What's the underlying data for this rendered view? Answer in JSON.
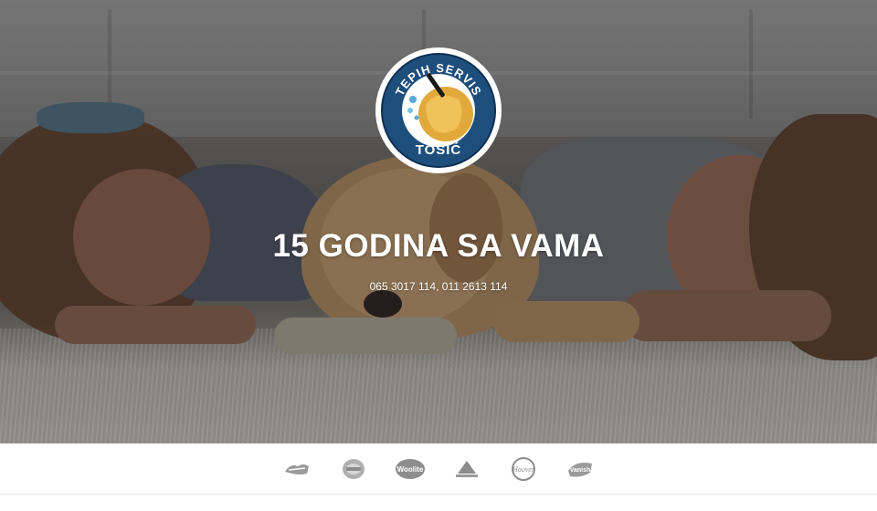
{
  "logo": {
    "top_text": "TEPIH SERVIS",
    "bottom_text": "TOŠIĆ",
    "colors": {
      "ring": "#1e4e7c",
      "inner": "#ffffff",
      "gold": "#e0a93a"
    }
  },
  "hero": {
    "headline": "15 GODINA SA VAMA",
    "phones": "065 3017 114, 011 2613 114"
  },
  "brands": [
    {
      "name": "Resolve-style logo",
      "icon": "brand-logo-1-icon"
    },
    {
      "name": "Round badge logo",
      "icon": "brand-logo-2-icon"
    },
    {
      "name": "Woolite",
      "icon": "woolite-logo-icon",
      "label": "Woolite"
    },
    {
      "name": "Triangle logo",
      "icon": "brand-logo-4-icon"
    },
    {
      "name": "Hoover",
      "icon": "hoover-logo-icon",
      "label": "Hoover"
    },
    {
      "name": "Vanish",
      "icon": "vanish-logo-icon",
      "label": "Vanish"
    }
  ]
}
